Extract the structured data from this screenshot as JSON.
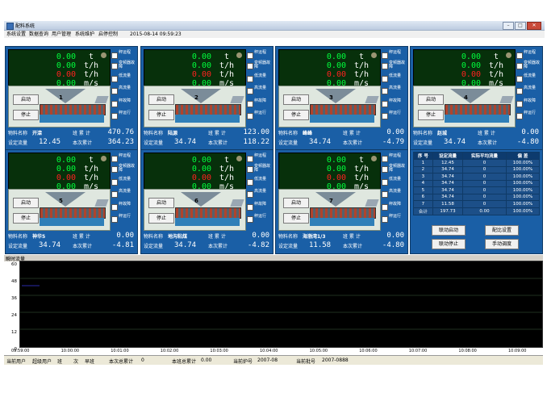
{
  "window": {
    "title": "配料系统"
  },
  "menu": [
    "系统设置",
    "数据查询",
    "用户管理",
    "系统维护",
    "启停控制"
  ],
  "datetime": "2015-08-14   09:59:23",
  "checks": [
    "秤运程",
    "变频器故障",
    "低流量",
    "高流量",
    "秤故障",
    "秤运行"
  ],
  "panel_labels": {
    "start": "启动",
    "stop": "停止",
    "material": "物料名称",
    "set_flow": "设定流量",
    "shift_total": "班 累 计",
    "current_total": "本次累计"
  },
  "units": [
    "t",
    "t/h",
    "t/h",
    "m/s"
  ],
  "panels": [
    {
      "id": "1",
      "material": "开滦",
      "set_flow": "12.45",
      "shift_total": "470.76",
      "current_total": "364.23",
      "readings": [
        "0.00",
        "0.00",
        "0.00",
        "0.00"
      ]
    },
    {
      "id": "2",
      "material": "陆源",
      "set_flow": "34.74",
      "shift_total": "123.00",
      "current_total": "118.22",
      "readings": [
        "0.00",
        "0.00",
        "0.00",
        "0.00"
      ]
    },
    {
      "id": "3",
      "material": "峰峰",
      "set_flow": "34.74",
      "shift_total": "0.00",
      "current_total": "-4.79",
      "readings": [
        "0.00",
        "0.00",
        "0.00",
        "0.00"
      ]
    },
    {
      "id": "4",
      "material": "赵城",
      "set_flow": "34.74",
      "shift_total": "0.00",
      "current_total": "-4.80",
      "readings": [
        "0.00",
        "0.00",
        "0.00",
        "0.00"
      ]
    },
    {
      "id": "5",
      "material": "神华5",
      "set_flow": "34.74",
      "shift_total": "0.00",
      "current_total": "-4.81",
      "readings": [
        "0.00",
        "0.00",
        "0.00",
        "0.00"
      ]
    },
    {
      "id": "6",
      "material": "地沟粘煤",
      "set_flow": "34.74",
      "shift_total": "0.00",
      "current_total": "-4.82",
      "readings": [
        "0.00",
        "0.00",
        "0.00",
        "0.00"
      ]
    },
    {
      "id": "7",
      "material": "海渤湾1/3",
      "set_flow": "11.58",
      "shift_total": "0.00",
      "current_total": "-4.80",
      "readings": [
        "0.00",
        "0.00",
        "0.00",
        "0.00"
      ]
    }
  ],
  "summary": {
    "headers": [
      "序 号",
      "设定流量",
      "实际平均流量",
      "偏 差"
    ],
    "rows": [
      [
        "1",
        "12.45",
        "0",
        "100.00%"
      ],
      [
        "2",
        "34.74",
        "0",
        "100.00%"
      ],
      [
        "3",
        "34.74",
        "0",
        "100.00%"
      ],
      [
        "4",
        "34.74",
        "0",
        "100.00%"
      ],
      [
        "5",
        "34.74",
        "0",
        "100.00%"
      ],
      [
        "6",
        "34.74",
        "0",
        "100.00%"
      ],
      [
        "7",
        "11.58",
        "0",
        "100.00%"
      ],
      [
        "合计",
        "197.73",
        "0.00",
        "100.00%"
      ]
    ],
    "buttons": {
      "link_start": "联动启动",
      "ratio": "配比设置",
      "link_stop": "联动停止",
      "manual": "手动调度"
    }
  },
  "trend": {
    "label": "瞬时流量",
    "yticks": [
      "60",
      "48",
      "36",
      "24",
      "12",
      "0"
    ],
    "xticks": [
      "09:59:00",
      "10:00:00",
      "10:01:00",
      "10:02:00",
      "10:03:00",
      "10:04:00",
      "10:05:00",
      "10:06:00",
      "10:07:00",
      "10:08:00",
      "10:09:00"
    ]
  },
  "status": {
    "user_label": "当前用户",
    "user": "超级用户",
    "shift_label": "班",
    "shift_label2": "次",
    "shift": "早班",
    "cur_total_label": "本次总累计",
    "cur_total": "0",
    "shift_total_label": "本班总累计",
    "shift_total": "0.00",
    "furnace_label": "当前炉号",
    "furnace": "2007-08",
    "batch_label": "当前批号",
    "batch": "2007-0888"
  },
  "colors": {
    "panel": "#1a5fa6",
    "display_bg": "#07300b",
    "green": "#00ff3c",
    "red": "#ff2020"
  }
}
